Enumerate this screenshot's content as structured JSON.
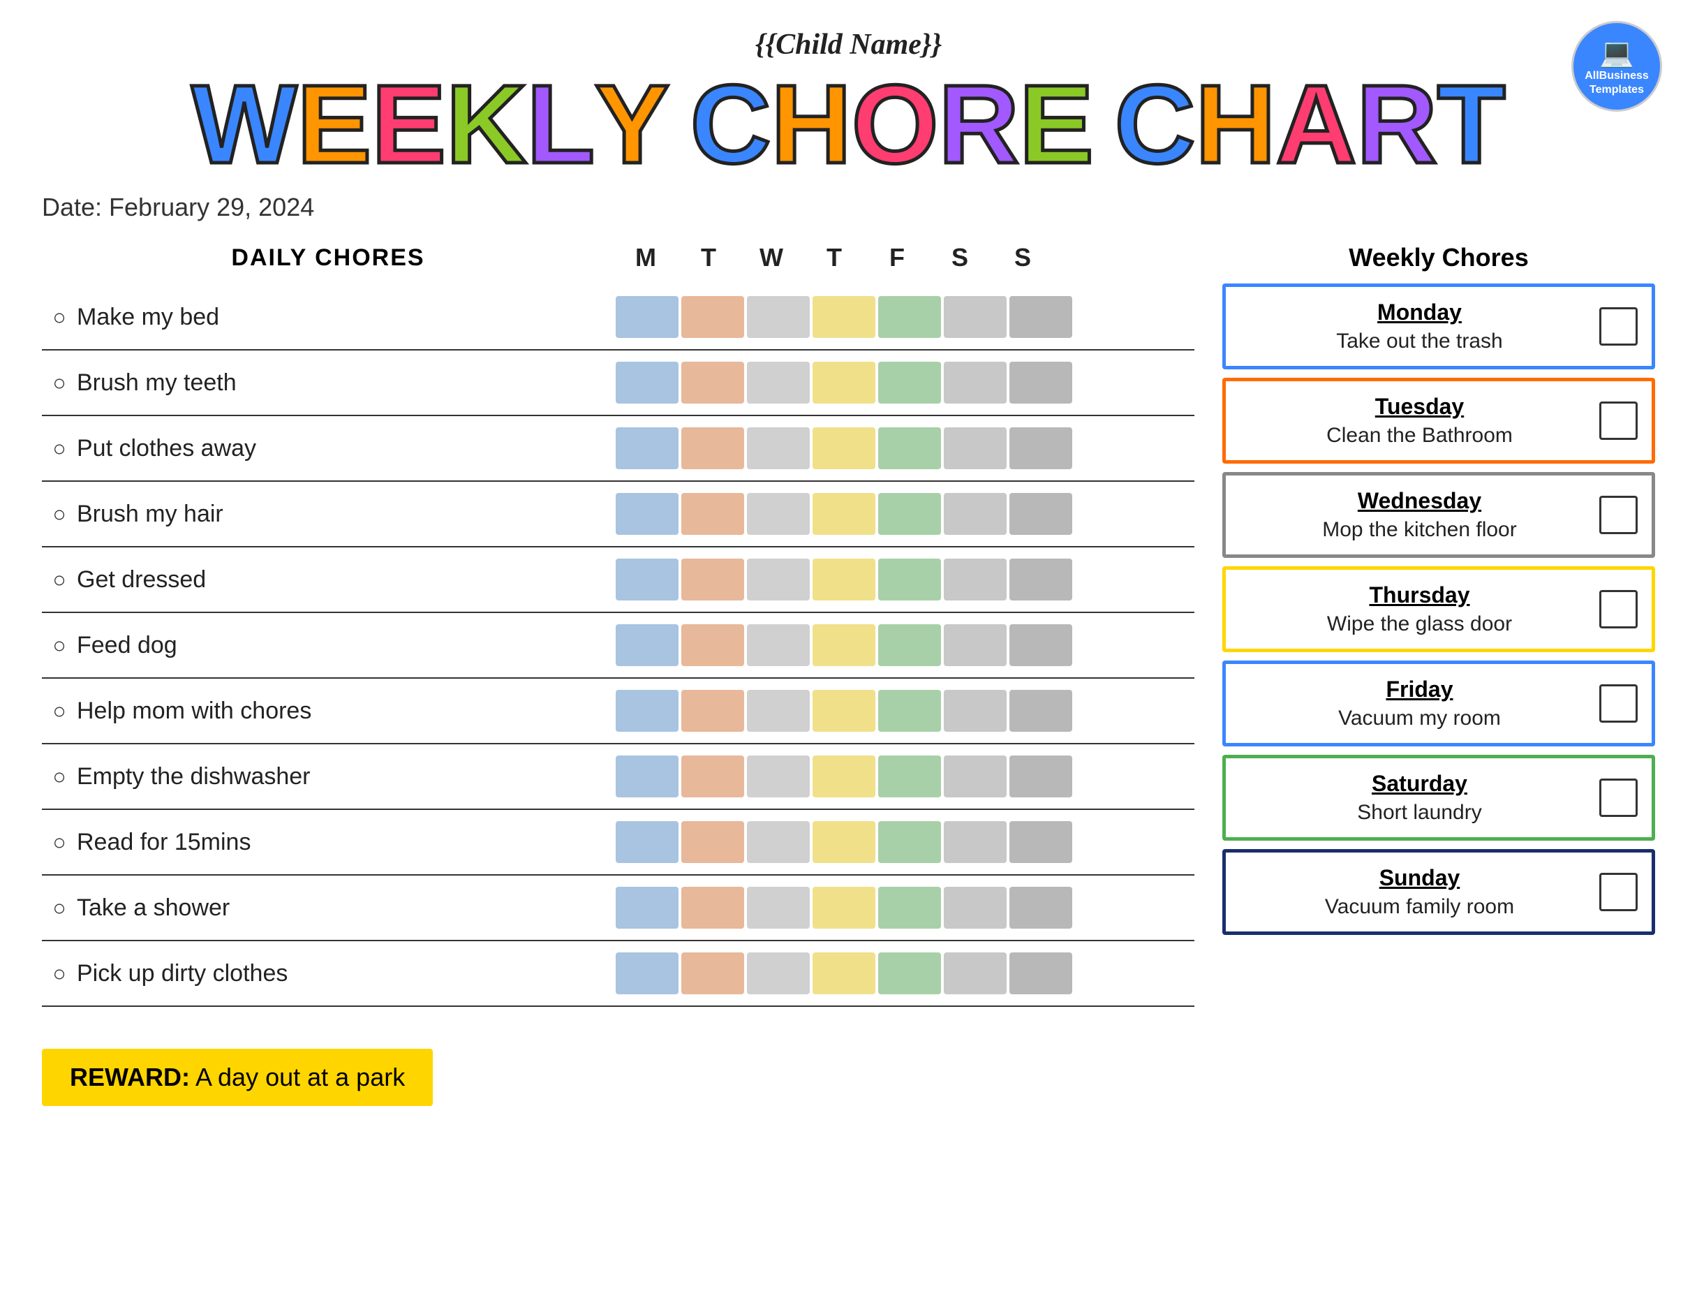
{
  "header": {
    "child_name": "{{Child Name}}",
    "date_label": "Date: February 29, 2024"
  },
  "big_title": {
    "word1": "WEEKLY",
    "word2": "CHORE",
    "word3": "CHART"
  },
  "columns": {
    "chores_label": "DAILY CHORES",
    "days": [
      "M",
      "T",
      "W",
      "T",
      "F",
      "S",
      "S"
    ]
  },
  "daily_chores": [
    "Make my bed",
    "Brush my teeth",
    "Put clothes away",
    "Brush my hair",
    "Get dressed",
    "Feed dog",
    "Help mom with chores",
    "Empty the dishwasher",
    "Read for 15mins",
    "Take a shower",
    "Pick up dirty clothes"
  ],
  "reward": {
    "label": "REWARD:",
    "value": "A day out at a park"
  },
  "weekly_section_title": "Weekly Chores",
  "weekly_chores": [
    {
      "day": "Monday",
      "task": "Take out the trash",
      "border": "border-blue"
    },
    {
      "day": "Tuesday",
      "task": "Clean the Bathroom",
      "border": "border-orange"
    },
    {
      "day": "Wednesday",
      "task": "Mop the kitchen floor",
      "border": "border-gray"
    },
    {
      "day": "Thursday",
      "task": "Wipe the glass door",
      "border": "border-gold"
    },
    {
      "day": "Friday",
      "task": "Vacuum my room",
      "border": "border-blue2"
    },
    {
      "day": "Saturday",
      "task": "Short laundry",
      "border": "border-green"
    },
    {
      "day": "Sunday",
      "task": "Vacuum family room",
      "border": "border-navy"
    }
  ],
  "logo": {
    "line1": "AllBusiness",
    "line2": "Templates"
  }
}
